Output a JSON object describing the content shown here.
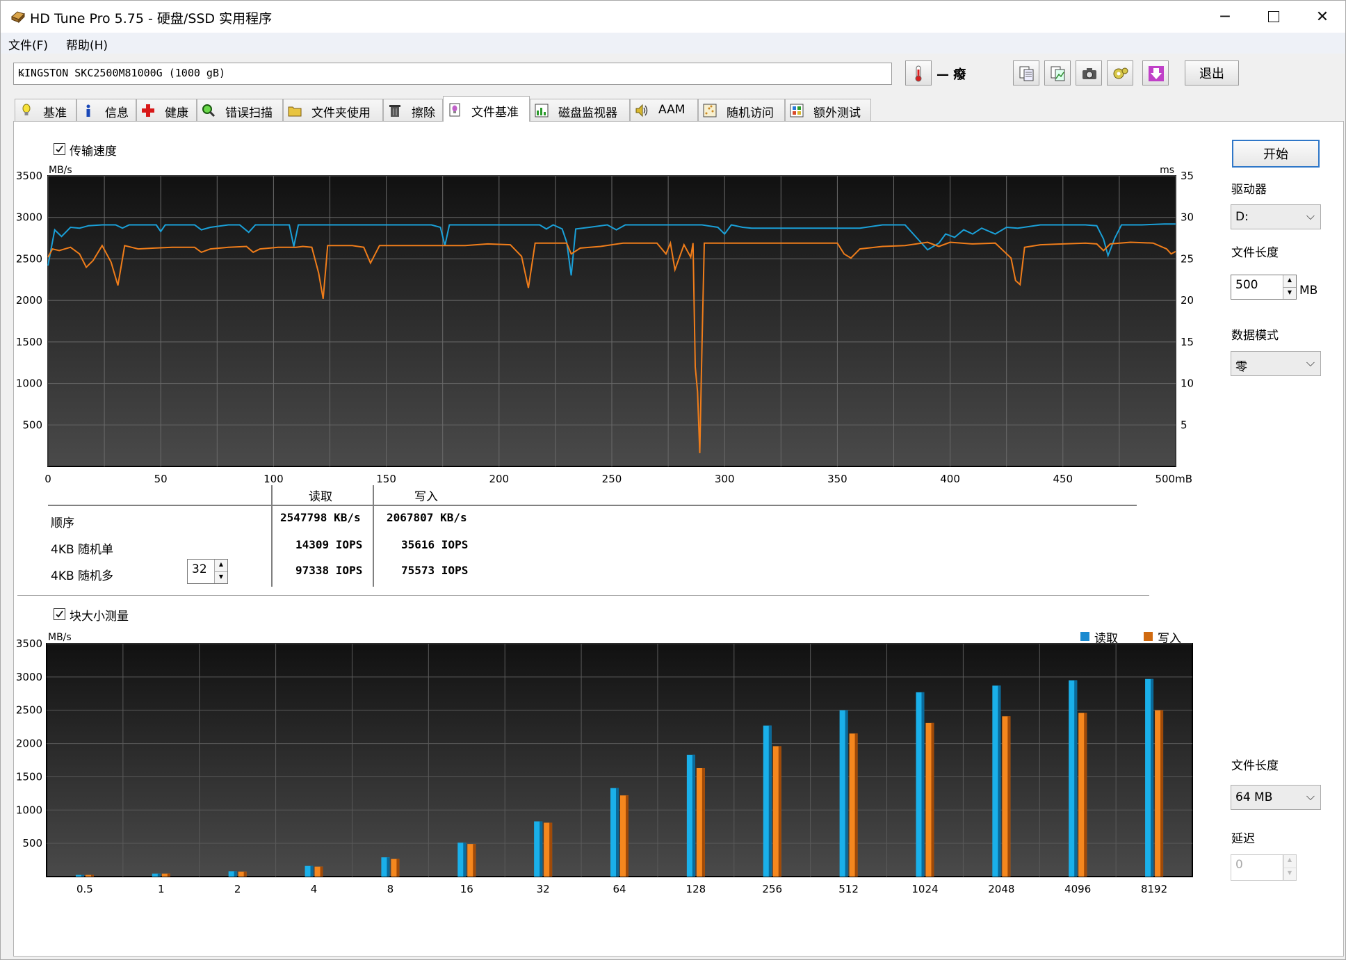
{
  "window": {
    "title": "HD Tune Pro 5.75 - 硬盘/SSD 实用程序"
  },
  "menu": [
    "文件(F)",
    "帮助(H)"
  ],
  "drive": {
    "name": "KINGSTON SKC2500M81000G (1000 gB)"
  },
  "toolbar": {
    "temperature": "— 癈",
    "exit_label": "退出"
  },
  "tabs": [
    {
      "label": "基准",
      "icon": "bulb-icon"
    },
    {
      "label": "信息",
      "icon": "info-icon"
    },
    {
      "label": "健康",
      "icon": "health-cross-icon"
    },
    {
      "label": "错误扫描",
      "icon": "magnifier-icon"
    },
    {
      "label": "文件夹使用",
      "icon": "folder-icon"
    },
    {
      "label": "擦除",
      "icon": "trash-icon"
    },
    {
      "label": "文件基准",
      "icon": "file-benchmark-icon"
    },
    {
      "label": "磁盘监视器",
      "icon": "monitor-chart-icon"
    },
    {
      "label": "AAM",
      "icon": "speaker-icon"
    },
    {
      "label": "随机访问",
      "icon": "random-access-icon"
    },
    {
      "label": "额外测试",
      "icon": "extra-tests-icon"
    }
  ],
  "colors": {
    "read": "#1aa0d8",
    "write": "#f07d1a"
  },
  "transfer": {
    "checkbox_label": "传输速度",
    "checked": true,
    "chart_data": {
      "type": "line",
      "y_unit_left": "MB/s",
      "y_unit_right": "ms",
      "x_unit": "mB",
      "xlim": [
        0,
        500
      ],
      "ylim_left": [
        0,
        3500
      ],
      "ylim_right": [
        0,
        35
      ],
      "x_ticks": [
        "0",
        "50",
        "100",
        "150",
        "200",
        "250",
        "300",
        "350",
        "400",
        "450",
        "500mB"
      ],
      "y_ticks_left": [
        "3500",
        "3000",
        "2500",
        "2000",
        "1500",
        "1000",
        "500"
      ],
      "y_ticks_right": [
        "35",
        "30",
        "25",
        "20",
        "15",
        "10",
        "5"
      ],
      "series": [
        {
          "name": "读取",
          "points": [
            [
              0,
              2420
            ],
            [
              3,
              2850
            ],
            [
              6,
              2770
            ],
            [
              10,
              2880
            ],
            [
              14,
              2870
            ],
            [
              18,
              2900
            ],
            [
              24,
              2910
            ],
            [
              30,
              2910
            ],
            [
              33,
              2870
            ],
            [
              36,
              2910
            ],
            [
              45,
              2910
            ],
            [
              48,
              2910
            ],
            [
              50,
              2830
            ],
            [
              52,
              2910
            ],
            [
              60,
              2910
            ],
            [
              65,
              2910
            ],
            [
              68,
              2850
            ],
            [
              72,
              2880
            ],
            [
              80,
              2910
            ],
            [
              85,
              2910
            ],
            [
              89,
              2820
            ],
            [
              92,
              2910
            ],
            [
              100,
              2910
            ],
            [
              107,
              2910
            ],
            [
              109,
              2650
            ],
            [
              111,
              2910
            ],
            [
              120,
              2910
            ],
            [
              130,
              2910
            ],
            [
              140,
              2910
            ],
            [
              150,
              2910
            ],
            [
              160,
              2910
            ],
            [
              170,
              2910
            ],
            [
              174,
              2880
            ],
            [
              176,
              2660
            ],
            [
              178,
              2910
            ],
            [
              190,
              2910
            ],
            [
              200,
              2910
            ],
            [
              210,
              2910
            ],
            [
              218,
              2910
            ],
            [
              221,
              2860
            ],
            [
              224,
              2910
            ],
            [
              228,
              2860
            ],
            [
              230,
              2700
            ],
            [
              232,
              2300
            ],
            [
              234,
              2860
            ],
            [
              240,
              2880
            ],
            [
              248,
              2910
            ],
            [
              252,
              2850
            ],
            [
              256,
              2910
            ],
            [
              270,
              2910
            ],
            [
              280,
              2910
            ],
            [
              290,
              2910
            ],
            [
              297,
              2880
            ],
            [
              300,
              2800
            ],
            [
              303,
              2910
            ],
            [
              308,
              2880
            ],
            [
              312,
              2870
            ],
            [
              320,
              2870
            ],
            [
              330,
              2870
            ],
            [
              340,
              2870
            ],
            [
              350,
              2870
            ],
            [
              360,
              2870
            ],
            [
              370,
              2910
            ],
            [
              380,
              2910
            ],
            [
              386,
              2730
            ],
            [
              390,
              2610
            ],
            [
              395,
              2690
            ],
            [
              398,
              2800
            ],
            [
              402,
              2760
            ],
            [
              406,
              2850
            ],
            [
              410,
              2800
            ],
            [
              414,
              2870
            ],
            [
              420,
              2800
            ],
            [
              425,
              2880
            ],
            [
              430,
              2870
            ],
            [
              440,
              2910
            ],
            [
              450,
              2910
            ],
            [
              460,
              2910
            ],
            [
              465,
              2900
            ],
            [
              468,
              2740
            ],
            [
              470,
              2540
            ],
            [
              473,
              2750
            ],
            [
              476,
              2910
            ],
            [
              485,
              2910
            ],
            [
              495,
              2920
            ],
            [
              500,
              2920
            ]
          ]
        },
        {
          "name": "写入",
          "points": [
            [
              0,
              2520
            ],
            [
              2,
              2620
            ],
            [
              5,
              2600
            ],
            [
              10,
              2640
            ],
            [
              14,
              2560
            ],
            [
              17,
              2400
            ],
            [
              20,
              2480
            ],
            [
              24,
              2660
            ],
            [
              28,
              2460
            ],
            [
              31,
              2180
            ],
            [
              34,
              2660
            ],
            [
              40,
              2620
            ],
            [
              47,
              2630
            ],
            [
              55,
              2640
            ],
            [
              65,
              2640
            ],
            [
              68,
              2580
            ],
            [
              72,
              2620
            ],
            [
              80,
              2640
            ],
            [
              88,
              2650
            ],
            [
              91,
              2580
            ],
            [
              94,
              2620
            ],
            [
              102,
              2640
            ],
            [
              110,
              2640
            ],
            [
              113,
              2650
            ],
            [
              117,
              2640
            ],
            [
              120,
              2330
            ],
            [
              122,
              2020
            ],
            [
              124,
              2660
            ],
            [
              135,
              2660
            ],
            [
              140,
              2640
            ],
            [
              143,
              2450
            ],
            [
              147,
              2660
            ],
            [
              160,
              2660
            ],
            [
              170,
              2660
            ],
            [
              178,
              2660
            ],
            [
              185,
              2660
            ],
            [
              195,
              2680
            ],
            [
              205,
              2670
            ],
            [
              210,
              2530
            ],
            [
              213,
              2150
            ],
            [
              216,
              2690
            ],
            [
              225,
              2690
            ],
            [
              230,
              2690
            ],
            [
              232,
              2560
            ],
            [
              236,
              2630
            ],
            [
              245,
              2650
            ],
            [
              255,
              2690
            ],
            [
              265,
              2690
            ],
            [
              270,
              2690
            ],
            [
              274,
              2560
            ],
            [
              276,
              2690
            ],
            [
              278,
              2370
            ],
            [
              282,
              2670
            ],
            [
              285,
              2520
            ],
            [
              286,
              2690
            ],
            [
              287,
              1200
            ],
            [
              288,
              900
            ],
            [
              289,
              160
            ],
            [
              290,
              1500
            ],
            [
              291,
              2690
            ],
            [
              300,
              2690
            ],
            [
              320,
              2690
            ],
            [
              340,
              2690
            ],
            [
              350,
              2690
            ],
            [
              353,
              2560
            ],
            [
              356,
              2510
            ],
            [
              360,
              2620
            ],
            [
              370,
              2650
            ],
            [
              380,
              2660
            ],
            [
              390,
              2700
            ],
            [
              395,
              2650
            ],
            [
              400,
              2700
            ],
            [
              410,
              2680
            ],
            [
              420,
              2690
            ],
            [
              427,
              2510
            ],
            [
              429,
              2240
            ],
            [
              431,
              2190
            ],
            [
              433,
              2640
            ],
            [
              440,
              2670
            ],
            [
              450,
              2680
            ],
            [
              460,
              2690
            ],
            [
              465,
              2680
            ],
            [
              468,
              2600
            ],
            [
              471,
              2680
            ],
            [
              480,
              2700
            ],
            [
              490,
              2690
            ],
            [
              496,
              2620
            ],
            [
              498,
              2560
            ],
            [
              500,
              2590
            ]
          ]
        }
      ]
    }
  },
  "results": {
    "headers": {
      "read": "读取",
      "write": "写入"
    },
    "rows": [
      {
        "label": "顺序",
        "read": "2547798 KB/s",
        "write": "2067807 KB/s"
      },
      {
        "label": "4KB 随机单",
        "read": "14309 IOPS",
        "write": "35616 IOPS"
      },
      {
        "label": "4KB 随机多",
        "read": "97338 IOPS",
        "write": "75573 IOPS"
      }
    ],
    "queue_depth": "32"
  },
  "block": {
    "checkbox_label": "块大小测量",
    "checked": true,
    "legend": {
      "read": "读取",
      "write": "写入"
    },
    "chart_data": {
      "type": "bar",
      "y_unit": "MB/s",
      "ylim": [
        0,
        3500
      ],
      "y_ticks": [
        "3500",
        "3000",
        "2500",
        "2000",
        "1500",
        "1000",
        "500"
      ],
      "categories": [
        "0.5",
        "1",
        "2",
        "4",
        "8",
        "16",
        "32",
        "64",
        "128",
        "256",
        "512",
        "1024",
        "2048",
        "4096",
        "8192"
      ],
      "series": [
        {
          "name": "读取",
          "values": [
            25,
            45,
            80,
            160,
            290,
            510,
            830,
            1330,
            1830,
            2270,
            2500,
            2770,
            2870,
            2950,
            2970
          ]
        },
        {
          "name": "写入",
          "values": [
            25,
            45,
            75,
            150,
            265,
            490,
            810,
            1220,
            1630,
            1960,
            2150,
            2310,
            2410,
            2460,
            2500
          ]
        }
      ]
    }
  },
  "sidebar": {
    "start_label": "开始",
    "drive_label": "驱动器",
    "drive_value": "D:",
    "file_length_label": "文件长度",
    "file_length_value": "500",
    "file_length_unit": "MB",
    "data_mode_label": "数据模式",
    "data_mode_value": "零",
    "file_length2_label": "文件长度",
    "file_length2_value": "64 MB",
    "delay_label": "延迟",
    "delay_value": "0"
  }
}
